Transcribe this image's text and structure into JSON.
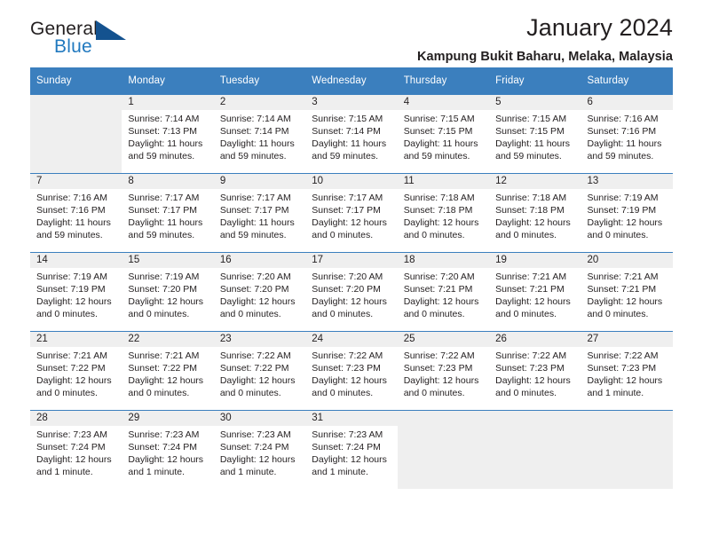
{
  "brand": {
    "word_one": "General",
    "word_two": "Blue",
    "logo_icon": "triangle-flag-icon",
    "color_dark": "#231f20",
    "color_blue": "#2179bf",
    "color_triangle": "#14528f"
  },
  "header": {
    "title": "January 2024",
    "subtitle": "Kampung Bukit Baharu, Melaka, Malaysia"
  },
  "theme": {
    "header_row_bg": "#3b7fbe",
    "header_row_text": "#ffffff",
    "daynum_band_bg": "#efefef",
    "empty_cell_bg": "#efefef",
    "cell_bg": "#ffffff",
    "grid_line": "#3b7fbe"
  },
  "weekdays": [
    "Sunday",
    "Monday",
    "Tuesday",
    "Wednesday",
    "Thursday",
    "Friday",
    "Saturday"
  ],
  "labels": {
    "sunrise_prefix": "Sunrise: ",
    "sunset_prefix": "Sunset: ",
    "daylight_prefix": "Daylight: "
  },
  "weeks": [
    [
      {
        "empty": true
      },
      {
        "day": "1",
        "sunrise": "Sunrise: 7:14 AM",
        "sunset": "Sunset: 7:13 PM",
        "daylight": "Daylight: 11 hours and 59 minutes."
      },
      {
        "day": "2",
        "sunrise": "Sunrise: 7:14 AM",
        "sunset": "Sunset: 7:14 PM",
        "daylight": "Daylight: 11 hours and 59 minutes."
      },
      {
        "day": "3",
        "sunrise": "Sunrise: 7:15 AM",
        "sunset": "Sunset: 7:14 PM",
        "daylight": "Daylight: 11 hours and 59 minutes."
      },
      {
        "day": "4",
        "sunrise": "Sunrise: 7:15 AM",
        "sunset": "Sunset: 7:15 PM",
        "daylight": "Daylight: 11 hours and 59 minutes."
      },
      {
        "day": "5",
        "sunrise": "Sunrise: 7:15 AM",
        "sunset": "Sunset: 7:15 PM",
        "daylight": "Daylight: 11 hours and 59 minutes."
      },
      {
        "day": "6",
        "sunrise": "Sunrise: 7:16 AM",
        "sunset": "Sunset: 7:16 PM",
        "daylight": "Daylight: 11 hours and 59 minutes."
      }
    ],
    [
      {
        "day": "7",
        "sunrise": "Sunrise: 7:16 AM",
        "sunset": "Sunset: 7:16 PM",
        "daylight": "Daylight: 11 hours and 59 minutes."
      },
      {
        "day": "8",
        "sunrise": "Sunrise: 7:17 AM",
        "sunset": "Sunset: 7:17 PM",
        "daylight": "Daylight: 11 hours and 59 minutes."
      },
      {
        "day": "9",
        "sunrise": "Sunrise: 7:17 AM",
        "sunset": "Sunset: 7:17 PM",
        "daylight": "Daylight: 11 hours and 59 minutes."
      },
      {
        "day": "10",
        "sunrise": "Sunrise: 7:17 AM",
        "sunset": "Sunset: 7:17 PM",
        "daylight": "Daylight: 12 hours and 0 minutes."
      },
      {
        "day": "11",
        "sunrise": "Sunrise: 7:18 AM",
        "sunset": "Sunset: 7:18 PM",
        "daylight": "Daylight: 12 hours and 0 minutes."
      },
      {
        "day": "12",
        "sunrise": "Sunrise: 7:18 AM",
        "sunset": "Sunset: 7:18 PM",
        "daylight": "Daylight: 12 hours and 0 minutes."
      },
      {
        "day": "13",
        "sunrise": "Sunrise: 7:19 AM",
        "sunset": "Sunset: 7:19 PM",
        "daylight": "Daylight: 12 hours and 0 minutes."
      }
    ],
    [
      {
        "day": "14",
        "sunrise": "Sunrise: 7:19 AM",
        "sunset": "Sunset: 7:19 PM",
        "daylight": "Daylight: 12 hours and 0 minutes."
      },
      {
        "day": "15",
        "sunrise": "Sunrise: 7:19 AM",
        "sunset": "Sunset: 7:20 PM",
        "daylight": "Daylight: 12 hours and 0 minutes."
      },
      {
        "day": "16",
        "sunrise": "Sunrise: 7:20 AM",
        "sunset": "Sunset: 7:20 PM",
        "daylight": "Daylight: 12 hours and 0 minutes."
      },
      {
        "day": "17",
        "sunrise": "Sunrise: 7:20 AM",
        "sunset": "Sunset: 7:20 PM",
        "daylight": "Daylight: 12 hours and 0 minutes."
      },
      {
        "day": "18",
        "sunrise": "Sunrise: 7:20 AM",
        "sunset": "Sunset: 7:21 PM",
        "daylight": "Daylight: 12 hours and 0 minutes."
      },
      {
        "day": "19",
        "sunrise": "Sunrise: 7:21 AM",
        "sunset": "Sunset: 7:21 PM",
        "daylight": "Daylight: 12 hours and 0 minutes."
      },
      {
        "day": "20",
        "sunrise": "Sunrise: 7:21 AM",
        "sunset": "Sunset: 7:21 PM",
        "daylight": "Daylight: 12 hours and 0 minutes."
      }
    ],
    [
      {
        "day": "21",
        "sunrise": "Sunrise: 7:21 AM",
        "sunset": "Sunset: 7:22 PM",
        "daylight": "Daylight: 12 hours and 0 minutes."
      },
      {
        "day": "22",
        "sunrise": "Sunrise: 7:21 AM",
        "sunset": "Sunset: 7:22 PM",
        "daylight": "Daylight: 12 hours and 0 minutes."
      },
      {
        "day": "23",
        "sunrise": "Sunrise: 7:22 AM",
        "sunset": "Sunset: 7:22 PM",
        "daylight": "Daylight: 12 hours and 0 minutes."
      },
      {
        "day": "24",
        "sunrise": "Sunrise: 7:22 AM",
        "sunset": "Sunset: 7:23 PM",
        "daylight": "Daylight: 12 hours and 0 minutes."
      },
      {
        "day": "25",
        "sunrise": "Sunrise: 7:22 AM",
        "sunset": "Sunset: 7:23 PM",
        "daylight": "Daylight: 12 hours and 0 minutes."
      },
      {
        "day": "26",
        "sunrise": "Sunrise: 7:22 AM",
        "sunset": "Sunset: 7:23 PM",
        "daylight": "Daylight: 12 hours and 0 minutes."
      },
      {
        "day": "27",
        "sunrise": "Sunrise: 7:22 AM",
        "sunset": "Sunset: 7:23 PM",
        "daylight": "Daylight: 12 hours and 1 minute."
      }
    ],
    [
      {
        "day": "28",
        "sunrise": "Sunrise: 7:23 AM",
        "sunset": "Sunset: 7:24 PM",
        "daylight": "Daylight: 12 hours and 1 minute."
      },
      {
        "day": "29",
        "sunrise": "Sunrise: 7:23 AM",
        "sunset": "Sunset: 7:24 PM",
        "daylight": "Daylight: 12 hours and 1 minute."
      },
      {
        "day": "30",
        "sunrise": "Sunrise: 7:23 AM",
        "sunset": "Sunset: 7:24 PM",
        "daylight": "Daylight: 12 hours and 1 minute."
      },
      {
        "day": "31",
        "sunrise": "Sunrise: 7:23 AM",
        "sunset": "Sunset: 7:24 PM",
        "daylight": "Daylight: 12 hours and 1 minute."
      },
      {
        "empty": true
      },
      {
        "empty": true
      },
      {
        "empty": true
      }
    ]
  ]
}
